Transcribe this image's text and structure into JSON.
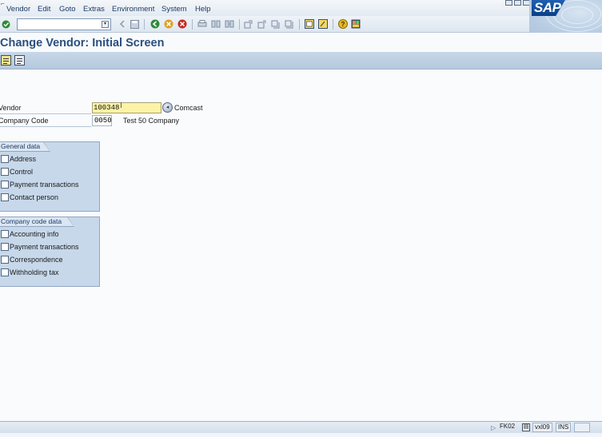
{
  "menu": {
    "items": [
      {
        "label": "Vendor"
      },
      {
        "label": "Edit"
      },
      {
        "label": "Goto"
      },
      {
        "label": "Extras"
      },
      {
        "label": "Environment"
      },
      {
        "label": "System"
      },
      {
        "label": "Help"
      }
    ]
  },
  "branding": {
    "logo_text": "SAP"
  },
  "toolbar": {
    "command_field_value": "",
    "icons": [
      "enter-icon",
      "back-nav-icon",
      "save-icon",
      "back-icon",
      "exit-icon",
      "cancel-icon",
      "print-icon",
      "find-icon",
      "find-next-icon",
      "first-page-icon",
      "previous-page-icon",
      "next-page-icon",
      "last-page-icon",
      "create-session-icon",
      "shortcut-icon",
      "help-icon",
      "layout-menu-icon"
    ]
  },
  "title": "Change Vendor:  Initial Screen",
  "app_toolbar": {
    "icons": [
      "select-all-icon",
      "deselect-all-icon"
    ]
  },
  "form": {
    "vendor": {
      "label": "Vendor",
      "value": "100348",
      "description": "Comcast"
    },
    "company_code": {
      "label": "Company Code",
      "value": "0050",
      "description": "Test 50 Company"
    }
  },
  "general_data": {
    "title": "General data",
    "items": [
      {
        "label": "Address",
        "checked": false
      },
      {
        "label": "Control",
        "checked": false
      },
      {
        "label": "Payment transactions",
        "checked": false
      },
      {
        "label": "Contact person",
        "checked": false
      }
    ]
  },
  "company_code_data": {
    "title": "Company code data",
    "items": [
      {
        "label": "Accounting info",
        "checked": false
      },
      {
        "label": "Payment transactions",
        "checked": false
      },
      {
        "label": "Correspondence",
        "checked": false
      },
      {
        "label": "Withholding tax",
        "checked": false
      }
    ]
  },
  "status": {
    "transaction": "FK02",
    "server": "vxl09",
    "mode": "INS"
  },
  "colors": {
    "title_blue": "#2a4f7e",
    "required_field": "#fdf3a6",
    "group_box": "#c7d8ea"
  }
}
